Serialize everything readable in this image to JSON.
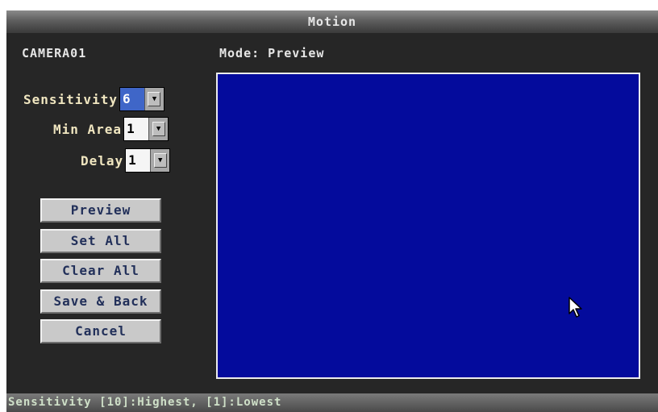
{
  "window": {
    "title": "Motion"
  },
  "header": {
    "camera": "CAMERA01",
    "mode": "Mode: Preview"
  },
  "fields": {
    "sensitivity": {
      "label": "Sensitivity",
      "value": "6"
    },
    "min_area": {
      "label": "Min Area",
      "value": "1"
    },
    "delay": {
      "label": "Delay",
      "value": "1"
    }
  },
  "buttons": {
    "preview": "Preview",
    "set_all": "Set All",
    "clear_all": "Clear All",
    "save_back": "Save & Back",
    "cancel": "Cancel"
  },
  "status": {
    "text": "Sensitivity [10]:Highest, [1]:Lowest"
  },
  "colors": {
    "grid_background": "#040b9c",
    "selected_value": "#3f66c8",
    "panel": "#262626"
  },
  "icons": {
    "dropdown": "chevron-down-icon",
    "pointer": "mouse-cursor-icon"
  }
}
